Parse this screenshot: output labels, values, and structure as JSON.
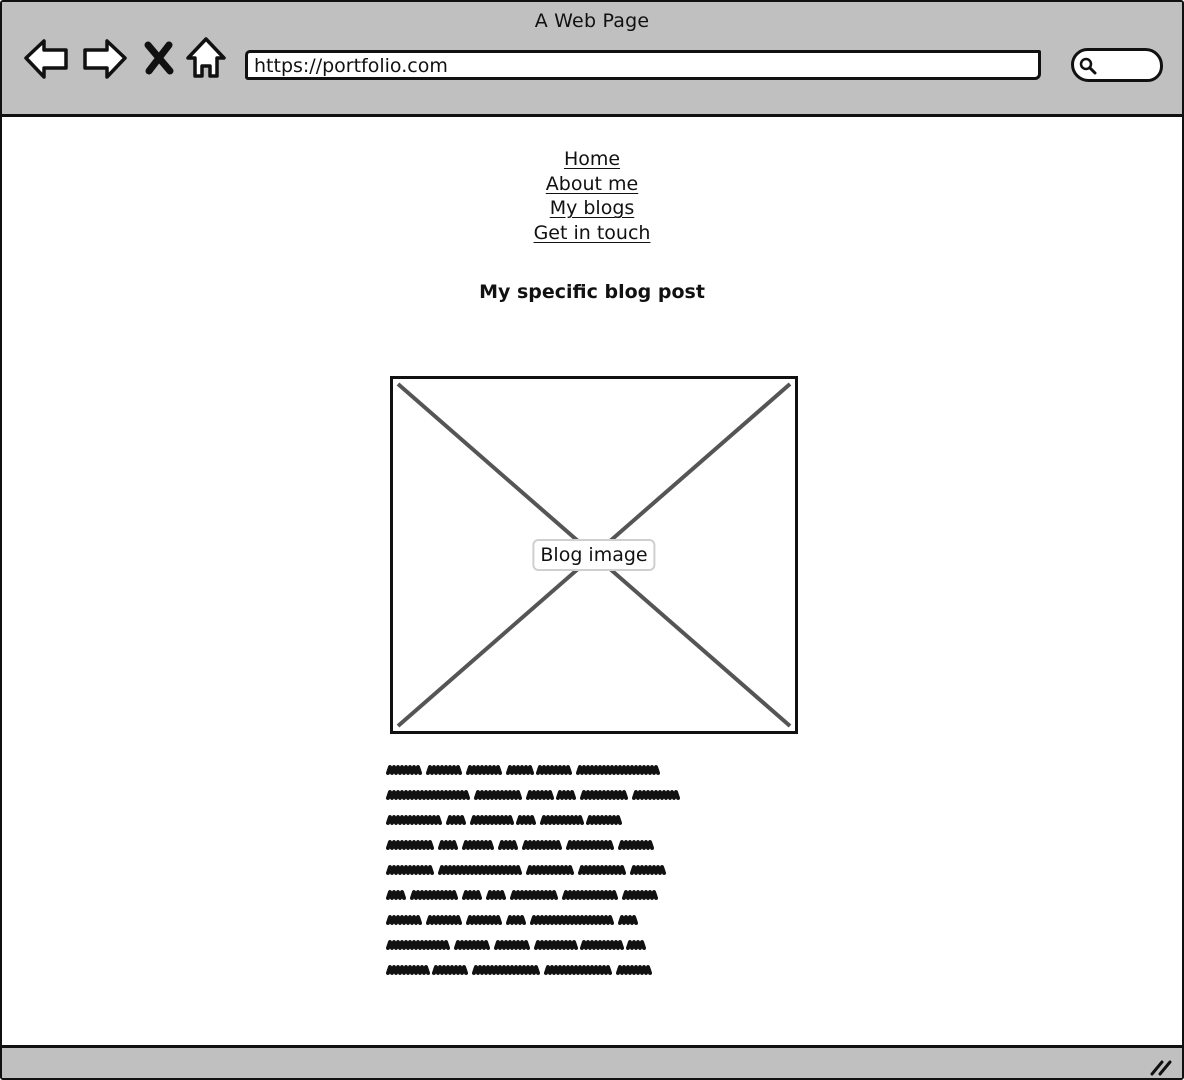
{
  "browser": {
    "title": "A Web Page",
    "url": "https://portfolio.com"
  },
  "nav_menu": {
    "items": [
      {
        "label": "Home"
      },
      {
        "label": "About me"
      },
      {
        "label": "My blogs"
      },
      {
        "label": "Get in touch"
      }
    ]
  },
  "post": {
    "title": "My specific blog post",
    "image_label": "Blog image"
  },
  "icons": {
    "back": "back-arrow-icon",
    "forward": "forward-arrow-icon",
    "stop": "close-x-icon",
    "home": "home-icon",
    "search": "search-icon",
    "resize": "resize-grip-icon"
  },
  "colors": {
    "chrome": "#c0c0c0",
    "ink": "#111111",
    "placeholder_cross": "#555555",
    "label_border": "#cfcfcf"
  }
}
